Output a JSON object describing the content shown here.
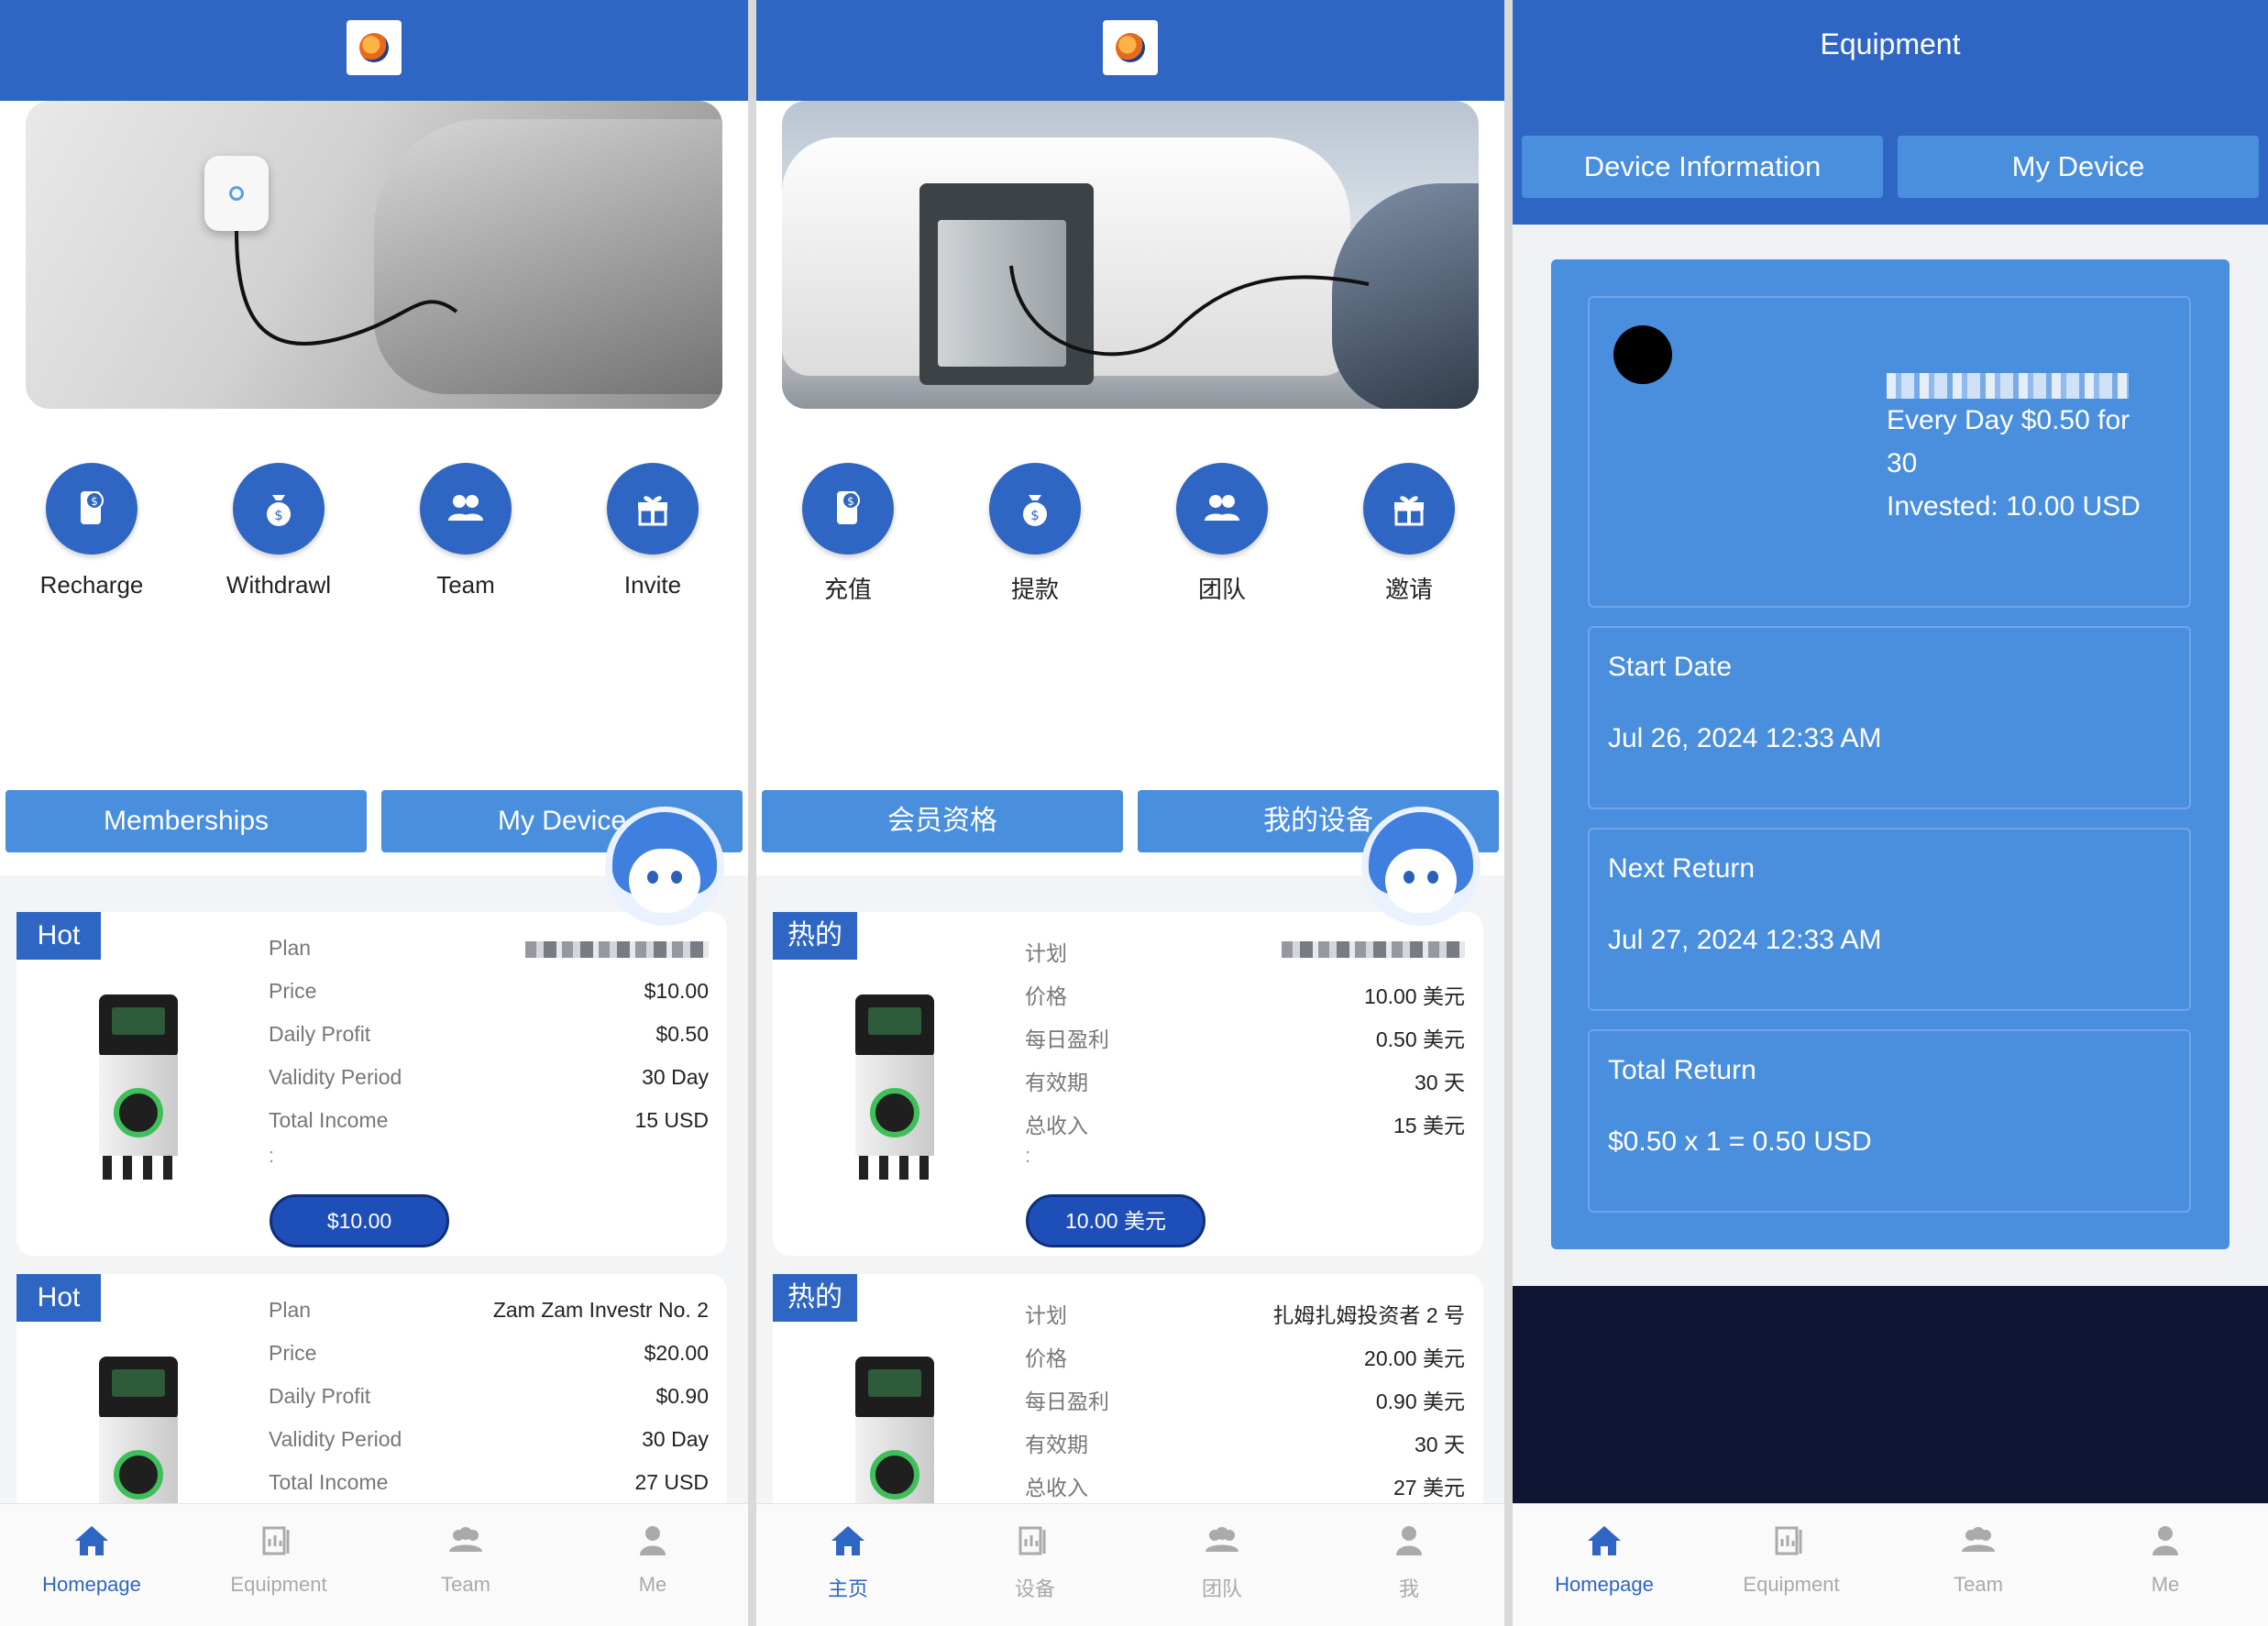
{
  "colors": {
    "brand_blue": "#2f66c4",
    "tab_blue": "#4a8ede",
    "buy_button": "#1e4fb8",
    "nav_inactive": "#aaaaaa",
    "dark_footer": "#0f1634"
  },
  "screens": [
    {
      "lang": "en",
      "actions": [
        {
          "label": "Recharge",
          "icon": "recharge-icon"
        },
        {
          "label": "Withdrawl",
          "icon": "withdraw-icon"
        },
        {
          "label": "Team",
          "icon": "team-icon"
        },
        {
          "label": "Invite",
          "icon": "gift-icon"
        }
      ],
      "tabs": [
        "Memberships",
        "My Device"
      ],
      "plans": [
        {
          "hot": "Hot",
          "rows": [
            {
              "k": "Plan",
              "v": ""
            },
            {
              "k": "Price",
              "v": "$10.00"
            },
            {
              "k": "Daily Profit",
              "v": "$0.50"
            },
            {
              "k": "Validity Period",
              "v": "30 Day"
            },
            {
              "k": "Total Income",
              "v": "15 USD"
            }
          ],
          "button": "$10.00"
        },
        {
          "hot": "Hot",
          "rows": [
            {
              "k": "Plan",
              "v": "Zam Zam Investr No. 2"
            },
            {
              "k": "Price",
              "v": "$20.00"
            },
            {
              "k": "Daily Profit",
              "v": "$0.90"
            },
            {
              "k": "Validity Period",
              "v": "30 Day"
            },
            {
              "k": "Total Income",
              "v": "27 USD"
            }
          ]
        }
      ],
      "nav": [
        "Homepage",
        "Equipment",
        "Team",
        "Me"
      ]
    },
    {
      "lang": "zh",
      "actions": [
        {
          "label": "充值",
          "icon": "recharge-icon"
        },
        {
          "label": "提款",
          "icon": "withdraw-icon"
        },
        {
          "label": "团队",
          "icon": "team-icon"
        },
        {
          "label": "邀请",
          "icon": "gift-icon"
        }
      ],
      "tabs": [
        "会员资格",
        "我的设备"
      ],
      "plans": [
        {
          "hot": "热的",
          "rows": [
            {
              "k": "计划",
              "v": ""
            },
            {
              "k": "价格",
              "v": "10.00 美元"
            },
            {
              "k": "每日盈利",
              "v": "0.50 美元"
            },
            {
              "k": "有效期",
              "v": "30 天"
            },
            {
              "k": "总收入",
              "v": "15 美元"
            }
          ],
          "button": "10.00 美元"
        },
        {
          "hot": "热的",
          "rows": [
            {
              "k": "计划",
              "v": "扎姆扎姆投资者 2 号"
            },
            {
              "k": "价格",
              "v": "20.00 美元"
            },
            {
              "k": "每日盈利",
              "v": "0.90 美元"
            },
            {
              "k": "有效期",
              "v": "30 天"
            },
            {
              "k": "总收入",
              "v": "27 美元"
            }
          ]
        }
      ],
      "nav": [
        "主页",
        "设备",
        "团队",
        "我"
      ]
    }
  ],
  "equipment": {
    "title": "Equipment",
    "tabs": [
      "Device Information",
      "My Device"
    ],
    "summary": {
      "line1": "Every Day $0.50 for",
      "line2": "30",
      "line3": "Invested: 10.00 USD"
    },
    "start_date": {
      "label": "Start Date",
      "value": "Jul 26, 2024 12:33 AM"
    },
    "next_return": {
      "label": "Next Return",
      "value": "Jul 27, 2024 12:33 AM"
    },
    "total_return": {
      "label": "Total Return",
      "value": "$0.50 x 1 = 0.50 USD"
    },
    "nav": [
      "Homepage",
      "Equipment",
      "Team",
      "Me"
    ]
  }
}
